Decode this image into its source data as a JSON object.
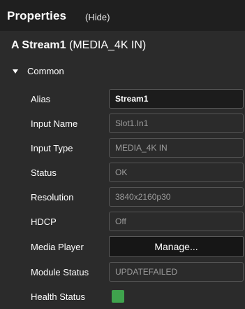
{
  "header": {
    "title": "Properties",
    "hide_label": "(Hide)"
  },
  "stream": {
    "name": "A Stream1",
    "type": "(MEDIA_4K IN)"
  },
  "section": {
    "label": "Common",
    "icon": "caret-down-icon"
  },
  "fields": {
    "alias": {
      "label": "Alias",
      "value": "Stream1"
    },
    "input_name": {
      "label": "Input Name",
      "value": "Slot1.In1"
    },
    "input_type": {
      "label": "Input Type",
      "value": "MEDIA_4K IN"
    },
    "status": {
      "label": "Status",
      "value": "OK"
    },
    "resolution": {
      "label": "Resolution",
      "value": "3840x2160p30"
    },
    "hdcp": {
      "label": "HDCP",
      "value": "Off"
    },
    "media_player": {
      "label": "Media Player",
      "button_label": "Manage..."
    },
    "module_status": {
      "label": "Module Status",
      "value": "UPDATEFAILED"
    },
    "health_status": {
      "label": "Health Status",
      "indicator_color": "#3fa34d"
    }
  }
}
